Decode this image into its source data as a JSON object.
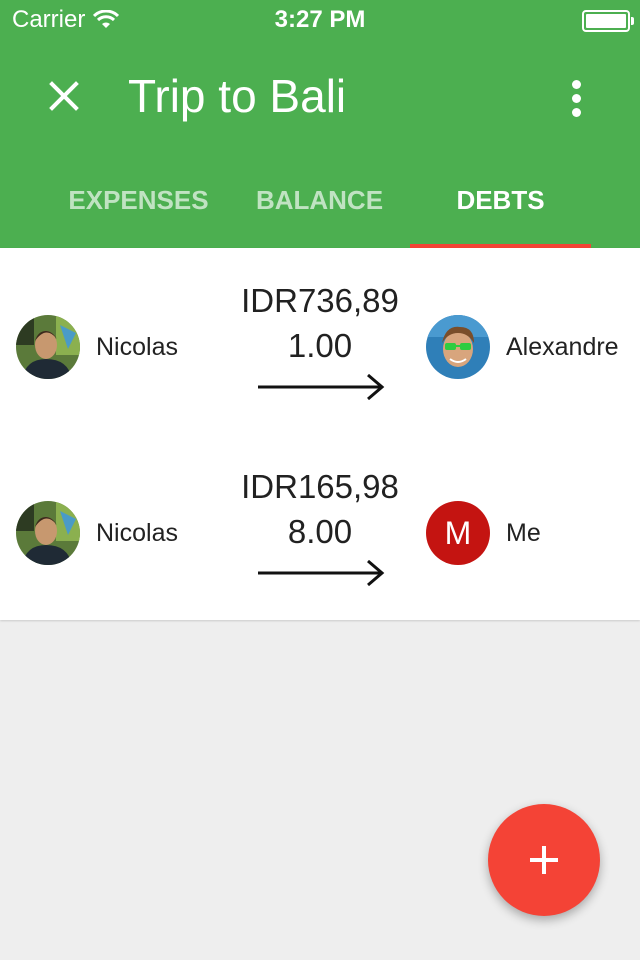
{
  "status_bar": {
    "carrier": "Carrier",
    "time": "3:27 PM"
  },
  "toolbar": {
    "title": "Trip to Bali",
    "close_icon": "close-icon",
    "more_icon": "more-vert-icon"
  },
  "tabs": [
    {
      "label": "EXPENSES",
      "active": false
    },
    {
      "label": "BALANCE",
      "active": false
    },
    {
      "label": "DEBTS",
      "active": true
    }
  ],
  "debts": [
    {
      "from": "Nicolas",
      "amount_line1": "IDR736,89",
      "amount_line2": "1.00",
      "to": "Alexandre"
    },
    {
      "from": "Nicolas",
      "amount_line1": "IDR165,98",
      "amount_line2": "8.00",
      "to": "Me",
      "to_initial": "M"
    }
  ],
  "colors": {
    "primary": "#4caf50",
    "accent": "#f44336",
    "avatar_me": "#c41411"
  },
  "fab": {
    "icon": "plus-icon"
  }
}
